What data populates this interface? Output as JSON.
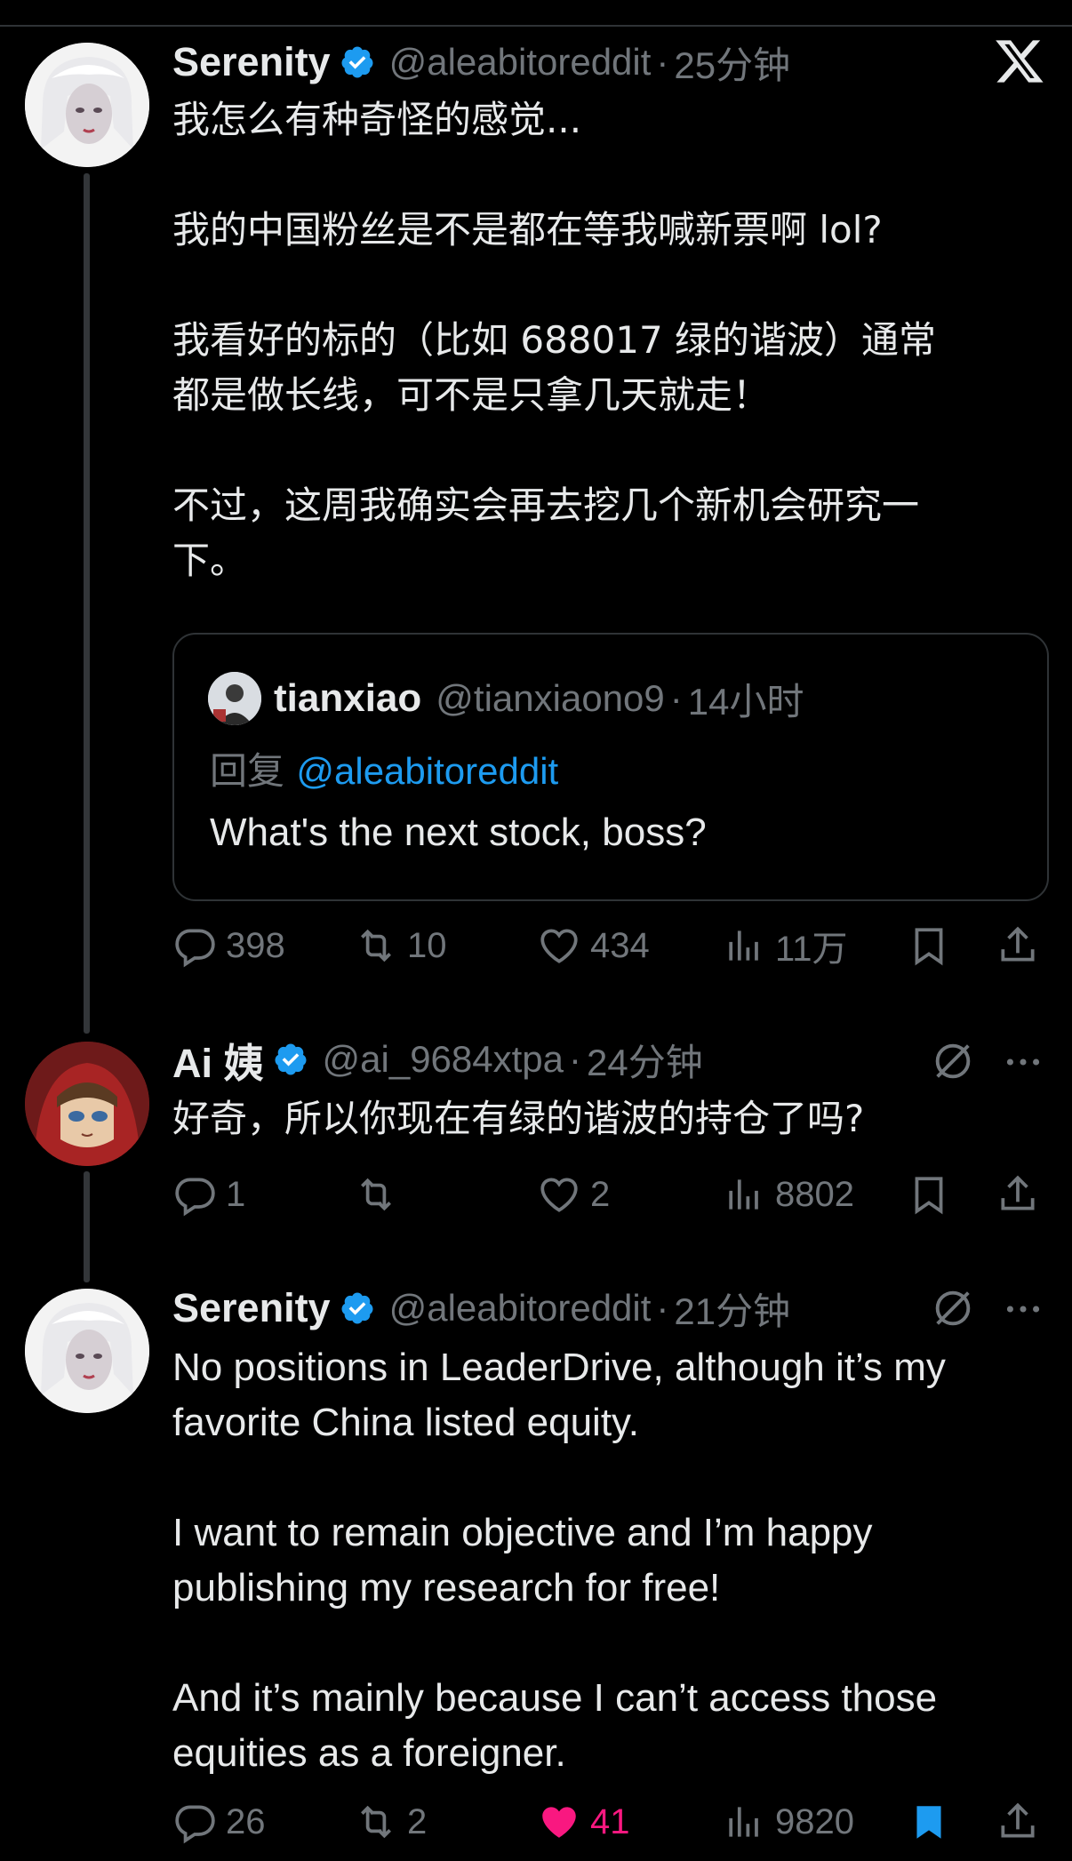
{
  "brand": {
    "logo_icon": "x-logo-icon"
  },
  "colors": {
    "accent": "#1d9bf0",
    "like": "#f91880",
    "muted": "#71767b",
    "text": "#e7e9ea"
  },
  "posts": [
    {
      "name": "Serenity",
      "verified": true,
      "handle": "@aleabitoreddit",
      "separator": "·",
      "time": "25分钟",
      "text": "我怎么有种奇怪的感觉...\n\n我的中国粉丝是不是都在等我喊新票啊 lol?\n\n我看好的标的（比如 688017 绿的谐波）通常\n都是做长线，可不是只拿几天就走！\n\n不过，这周我确实会再去挖几个新机会研究一\n下。",
      "quote": {
        "name": "tianxiao",
        "handle": "@tianxiaono9",
        "separator": "·",
        "time": "14小时",
        "reply_prefix": "回复",
        "reply_to": "@aleabitoreddit",
        "text": "What's the next stock, boss?"
      },
      "actions": {
        "replies": "398",
        "reposts": "10",
        "likes": "434",
        "views": "11万"
      }
    },
    {
      "name": "Ai 姨",
      "verified": true,
      "handle": "@ai_9684xtpa",
      "separator": "·",
      "time": "24分钟",
      "text": "好奇，所以你现在有绿的谐波的持仓了吗?",
      "actions": {
        "replies": "1",
        "reposts": "",
        "likes": "2",
        "views": "8802"
      }
    },
    {
      "name": "Serenity",
      "verified": true,
      "handle": "@aleabitoreddit",
      "separator": "·",
      "time": "21分钟",
      "text": "No positions in LeaderDrive, although it’s my\nfavorite China listed equity.\n\nI want to remain objective and I’m happy\npublishing my research for free!\n\nAnd it’s mainly because I can’t access those\nequities as a foreigner.",
      "actions": {
        "replies": "26",
        "reposts": "2",
        "likes": "41",
        "views": "9820",
        "liked": true,
        "bookmarked": true
      }
    }
  ]
}
